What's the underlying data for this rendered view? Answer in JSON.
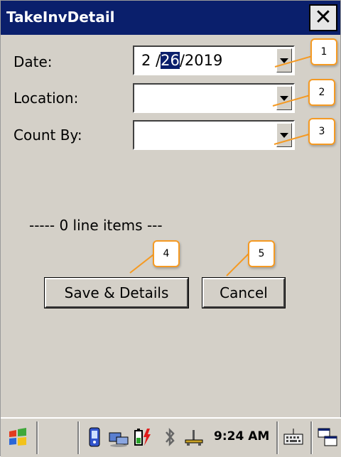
{
  "window": {
    "title": "TakeInvDetail",
    "close_label": "✕"
  },
  "form": {
    "date": {
      "label": "Date:",
      "value_month": "2 /",
      "value_day": "26",
      "value_year": "/2019"
    },
    "location": {
      "label": "Location:",
      "value": ""
    },
    "count_by": {
      "label": "Count By:",
      "value": ""
    }
  },
  "summary": {
    "line_items": "----- 0 line items ---"
  },
  "buttons": {
    "save": "Save & Details",
    "cancel": "Cancel"
  },
  "callouts": [
    "1",
    "2",
    "3",
    "4",
    "5"
  ],
  "taskbar": {
    "clock": "9:24 AM"
  },
  "colors": {
    "titlebar": "#0a1f6c",
    "callout_border": "#f59a23",
    "window_bg": "#d4d0c8"
  }
}
